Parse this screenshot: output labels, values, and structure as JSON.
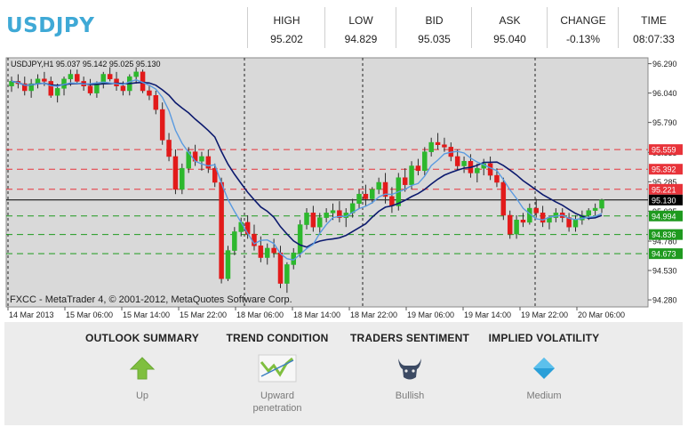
{
  "symbol": "USDJPY",
  "quotes": [
    {
      "label": "HIGH",
      "value": "95.202"
    },
    {
      "label": "LOW",
      "value": "94.829"
    },
    {
      "label": "BID",
      "value": "95.035"
    },
    {
      "label": "ASK",
      "value": "95.040"
    },
    {
      "label": "CHANGE",
      "value": "-0.13%"
    },
    {
      "label": "TIME",
      "value": "08:07:33"
    }
  ],
  "chart": {
    "header_text": "USDJPY,H1  95.037 95.142 95.025 95.130",
    "watermark": "FXCC - MetaTrader 4, © 2001-2012, MetaQuotes Software Corp.",
    "y_ticks": [
      "96.290",
      "96.040",
      "95.790",
      "95.535",
      "95.285",
      "95.035",
      "94.780",
      "94.530",
      "94.280"
    ],
    "x_ticks": [
      "14 Mar 2013",
      "15 Mar 06:00",
      "15 Mar 14:00",
      "15 Mar 22:00",
      "18 Mar 06:00",
      "18 Mar 14:00",
      "18 Mar 22:00",
      "19 Mar 06:00",
      "19 Mar 14:00",
      "19 Mar 22:00",
      "20 Mar 06:00"
    ],
    "levels": [
      {
        "value": "95.559",
        "color": "#e8333a"
      },
      {
        "value": "95.392",
        "color": "#e8333a"
      },
      {
        "value": "95.221",
        "color": "#e8333a"
      },
      {
        "value": "95.130",
        "color": "#000000"
      },
      {
        "value": "94.994",
        "color": "#1f9a1f"
      },
      {
        "value": "94.836",
        "color": "#1f9a1f"
      },
      {
        "value": "94.673",
        "color": "#1f9a1f"
      }
    ],
    "partial_tick": "95.035"
  },
  "chart_data": {
    "type": "candlestick",
    "symbol": "USDJPY,H1",
    "ylim": [
      94.22,
      96.34
    ],
    "candles_ohlc_approx": [
      [
        96.1,
        96.18,
        96.05,
        96.14
      ],
      [
        96.14,
        96.2,
        96.08,
        96.12
      ],
      [
        96.12,
        96.18,
        96.02,
        96.06
      ],
      [
        96.06,
        96.16,
        96.0,
        96.12
      ],
      [
        96.12,
        96.2,
        96.08,
        96.16
      ],
      [
        96.16,
        96.22,
        96.1,
        96.14
      ],
      [
        96.14,
        96.18,
        96.0,
        96.02
      ],
      [
        96.02,
        96.12,
        95.96,
        96.08
      ],
      [
        96.08,
        96.18,
        96.02,
        96.16
      ],
      [
        96.16,
        96.24,
        96.1,
        96.2
      ],
      [
        96.2,
        96.24,
        96.12,
        96.14
      ],
      [
        96.14,
        96.18,
        96.06,
        96.1
      ],
      [
        96.1,
        96.16,
        96.02,
        96.04
      ],
      [
        96.04,
        96.14,
        96.0,
        96.12
      ],
      [
        96.12,
        96.22,
        96.08,
        96.2
      ],
      [
        96.2,
        96.26,
        96.14,
        96.16
      ],
      [
        96.16,
        96.22,
        96.06,
        96.1
      ],
      [
        96.1,
        96.14,
        96.02,
        96.06
      ],
      [
        96.06,
        96.2,
        96.02,
        96.18
      ],
      [
        96.18,
        96.26,
        96.12,
        96.22
      ],
      [
        96.22,
        96.24,
        96.04,
        96.06
      ],
      [
        96.06,
        96.1,
        95.98,
        96.02
      ],
      [
        96.02,
        96.06,
        95.86,
        95.9
      ],
      [
        95.9,
        95.96,
        95.6,
        95.64
      ],
      [
        95.64,
        95.7,
        95.46,
        95.5
      ],
      [
        95.5,
        95.56,
        95.18,
        95.22
      ],
      [
        95.22,
        95.44,
        95.18,
        95.4
      ],
      [
        95.4,
        95.58,
        95.36,
        95.54
      ],
      [
        95.54,
        95.6,
        95.42,
        95.46
      ],
      [
        95.46,
        95.54,
        95.38,
        95.5
      ],
      [
        95.5,
        95.56,
        95.36,
        95.4
      ],
      [
        95.4,
        95.44,
        95.24,
        95.28
      ],
      [
        95.28,
        95.32,
        94.42,
        94.46
      ],
      [
        94.46,
        94.74,
        94.44,
        94.7
      ],
      [
        94.7,
        94.9,
        94.66,
        94.86
      ],
      [
        94.86,
        94.98,
        94.82,
        94.94
      ],
      [
        94.94,
        95.0,
        94.8,
        94.84
      ],
      [
        94.84,
        94.92,
        94.7,
        94.74
      ],
      [
        94.74,
        94.82,
        94.6,
        94.64
      ],
      [
        94.64,
        94.76,
        94.58,
        94.72
      ],
      [
        94.72,
        94.8,
        94.64,
        94.68
      ],
      [
        94.68,
        94.74,
        94.38,
        94.42
      ],
      [
        94.42,
        94.6,
        94.34,
        94.58
      ],
      [
        94.58,
        94.72,
        94.54,
        94.68
      ],
      [
        94.68,
        94.96,
        94.64,
        94.92
      ],
      [
        94.92,
        95.06,
        94.88,
        95.02
      ],
      [
        95.02,
        95.08,
        94.86,
        94.9
      ],
      [
        94.9,
        95.02,
        94.84,
        94.98
      ],
      [
        94.98,
        95.06,
        94.94,
        95.02
      ],
      [
        95.02,
        95.1,
        94.96,
        95.04
      ],
      [
        95.04,
        95.12,
        94.94,
        94.98
      ],
      [
        94.98,
        95.06,
        94.9,
        95.02
      ],
      [
        95.02,
        95.14,
        94.98,
        95.1
      ],
      [
        95.1,
        95.22,
        95.06,
        95.18
      ],
      [
        95.18,
        95.26,
        95.08,
        95.14
      ],
      [
        95.14,
        95.24,
        95.1,
        95.22
      ],
      [
        95.22,
        95.32,
        95.18,
        95.28
      ],
      [
        95.28,
        95.36,
        95.1,
        95.16
      ],
      [
        95.16,
        95.24,
        95.02,
        95.08
      ],
      [
        95.08,
        95.36,
        95.04,
        95.32
      ],
      [
        95.32,
        95.4,
        95.2,
        95.26
      ],
      [
        95.26,
        95.46,
        95.22,
        95.42
      ],
      [
        95.42,
        95.48,
        95.34,
        95.38
      ],
      [
        95.38,
        95.58,
        95.34,
        95.54
      ],
      [
        95.54,
        95.66,
        95.5,
        95.62
      ],
      [
        95.62,
        95.7,
        95.56,
        95.6
      ],
      [
        95.6,
        95.66,
        95.54,
        95.58
      ],
      [
        95.58,
        95.62,
        95.46,
        95.5
      ],
      [
        95.5,
        95.56,
        95.38,
        95.42
      ],
      [
        95.42,
        95.5,
        95.36,
        95.46
      ],
      [
        95.46,
        95.52,
        95.32,
        95.36
      ],
      [
        95.36,
        95.44,
        95.28,
        95.4
      ],
      [
        95.4,
        95.48,
        95.34,
        95.44
      ],
      [
        95.44,
        95.5,
        95.3,
        95.34
      ],
      [
        95.34,
        95.4,
        95.24,
        95.28
      ],
      [
        95.28,
        95.32,
        94.96,
        95.0
      ],
      [
        95.0,
        95.04,
        94.8,
        94.84
      ],
      [
        94.84,
        95.0,
        94.8,
        94.96
      ],
      [
        94.96,
        95.02,
        94.9,
        94.94
      ],
      [
        94.94,
        95.1,
        94.92,
        95.06
      ],
      [
        95.06,
        95.14,
        94.98,
        95.02
      ],
      [
        95.02,
        95.08,
        94.9,
        94.94
      ],
      [
        94.94,
        95.0,
        94.88,
        94.98
      ],
      [
        94.98,
        95.06,
        94.94,
        95.02
      ],
      [
        95.02,
        95.06,
        94.94,
        94.98
      ],
      [
        94.98,
        95.02,
        94.86,
        94.9
      ],
      [
        94.9,
        95.0,
        94.86,
        94.96
      ],
      [
        94.96,
        95.04,
        94.92,
        95.0
      ],
      [
        95.0,
        95.06,
        94.96,
        95.04
      ],
      [
        95.04,
        95.1,
        95.0,
        95.06
      ],
      [
        95.06,
        95.14,
        95.02,
        95.13
      ]
    ]
  },
  "indicators": [
    {
      "title": "OUTLOOK SUMMARY",
      "label": "Up",
      "icon": "up-arrow-icon",
      "color": "#7fbf3f"
    },
    {
      "title": "TREND CONDITION",
      "label": "Upward penetration",
      "icon": "trend-chart-icon",
      "color": "#7fbf3f"
    },
    {
      "title": "TRADERS SENTIMENT",
      "label": "Bullish",
      "icon": "bull-icon",
      "color": "#3c4a63"
    },
    {
      "title": "IMPLIED VOLATILITY",
      "label": "Medium",
      "icon": "volatility-diamond-icon",
      "color": "#2a9fd8"
    }
  ]
}
